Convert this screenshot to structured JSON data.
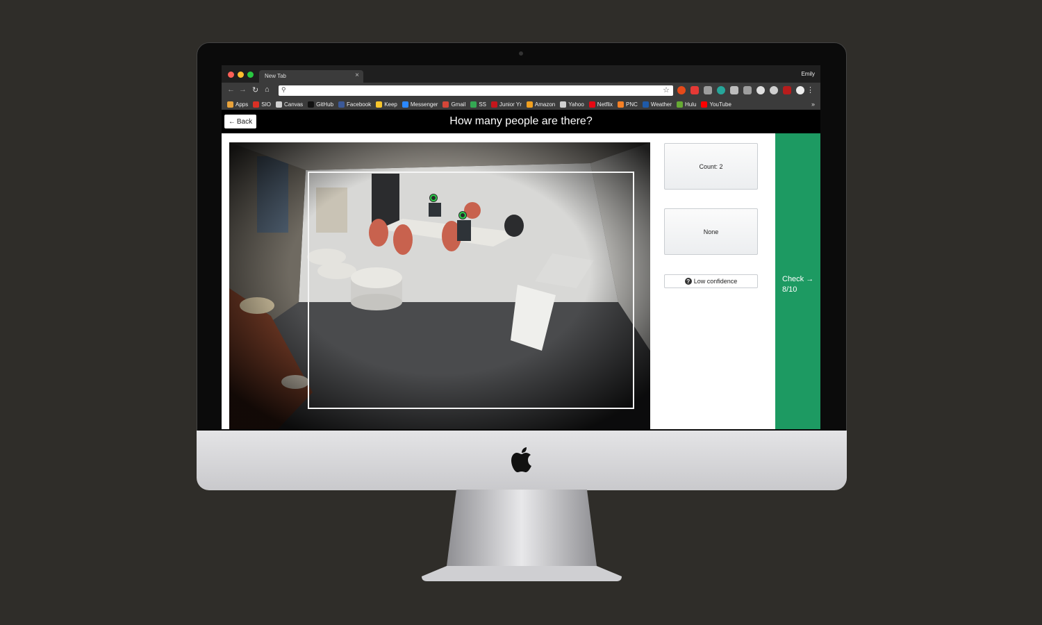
{
  "browser": {
    "tab_title": "New Tab",
    "tab_close": "×",
    "profile_name": "Emily",
    "nav": {
      "back": "←",
      "forward": "→",
      "reload": "↻",
      "home": "⌂"
    },
    "omnibox_value": "",
    "menu": "⋮",
    "bookmarks_more": "»",
    "bookmarks": [
      {
        "label": "Apps",
        "icon": "apps-grid-icon",
        "color": "#e8a23a"
      },
      {
        "label": "SIO",
        "icon": "sio-icon",
        "color": "#d93025"
      },
      {
        "label": "Canvas",
        "icon": "page-icon",
        "color": "#d0d0d0"
      },
      {
        "label": "GitHub",
        "icon": "github-icon",
        "color": "#111111"
      },
      {
        "label": "Facebook",
        "icon": "facebook-icon",
        "color": "#3b5998"
      },
      {
        "label": "Keep",
        "icon": "keep-icon",
        "color": "#f7c52b"
      },
      {
        "label": "Messenger",
        "icon": "messenger-icon",
        "color": "#2b88ff"
      },
      {
        "label": "Gmail",
        "icon": "gmail-icon",
        "color": "#d44638"
      },
      {
        "label": "SS",
        "icon": "drive-icon",
        "color": "#34a853"
      },
      {
        "label": "Junior Yr",
        "icon": "c-icon",
        "color": "#c4161c"
      },
      {
        "label": "Amazon",
        "icon": "amazon-icon",
        "color": "#f0a020"
      },
      {
        "label": "Yahoo",
        "icon": "page-icon",
        "color": "#d0d0d0"
      },
      {
        "label": "Netflix",
        "icon": "netflix-icon",
        "color": "#e50914"
      },
      {
        "label": "PNC",
        "icon": "pnc-icon",
        "color": "#f58025"
      },
      {
        "label": "Weather",
        "icon": "weather-icon",
        "color": "#1e5aa8"
      },
      {
        "label": "Hulu",
        "icon": "hulu-icon",
        "color": "#66aa33"
      },
      {
        "label": "YouTube",
        "icon": "youtube-icon",
        "color": "#ff0000"
      }
    ]
  },
  "app": {
    "back_label": "Back",
    "back_arrow": "←",
    "question": "How many people are there?",
    "count_label": "Count: 2",
    "none_label": "None",
    "low_confidence_label": "Low confidence",
    "low_confidence_icon": "?",
    "check_label": "Check →",
    "progress": "8/10",
    "accent_color": "#1d9a62"
  }
}
